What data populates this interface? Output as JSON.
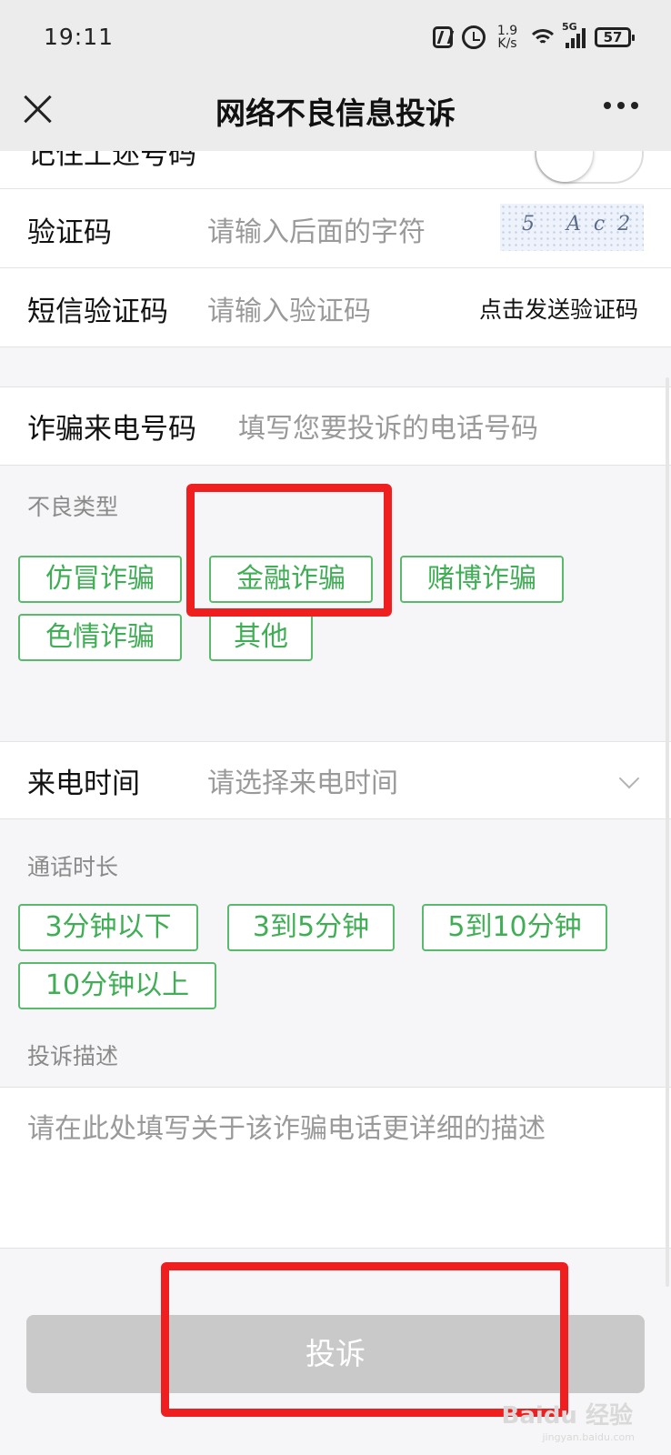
{
  "status_bar": {
    "time": "19:11",
    "speed_value": "1.9",
    "speed_unit": "K/s",
    "network": "5G",
    "battery": "57"
  },
  "nav": {
    "title": "网络不良信息投诉"
  },
  "form": {
    "remember_label": "记住上述号码",
    "captcha": {
      "label": "验证码",
      "placeholder": "请输入后面的字符",
      "image_text": "5 Ac2"
    },
    "sms": {
      "label": "短信验证码",
      "placeholder": "请输入验证码",
      "send_label": "点击发送验证码"
    },
    "phone": {
      "label": "诈骗来电号码",
      "placeholder": "填写您要投诉的电话号码"
    },
    "bad_type": {
      "label": "不良类型",
      "options": [
        "仿冒诈骗",
        "金融诈骗",
        "赌博诈骗",
        "色情诈骗",
        "其他"
      ]
    },
    "call_time": {
      "label": "来电时间",
      "placeholder": "请选择来电时间"
    },
    "duration": {
      "label": "通话时长",
      "options": [
        "3分钟以下",
        "3到5分钟",
        "5到10分钟",
        "10分钟以上"
      ]
    },
    "description": {
      "label": "投诉描述",
      "placeholder": "请在此处填写关于该诈骗电话更详细的描述"
    },
    "submit_label": "投诉"
  },
  "watermark": {
    "brand": "Baidu 经验",
    "site": "jingyan.baidu.com"
  },
  "colors": {
    "accent_green": "#57bb6b",
    "highlight_red": "#f01f1f",
    "disabled_button": "#c9c9c9"
  }
}
